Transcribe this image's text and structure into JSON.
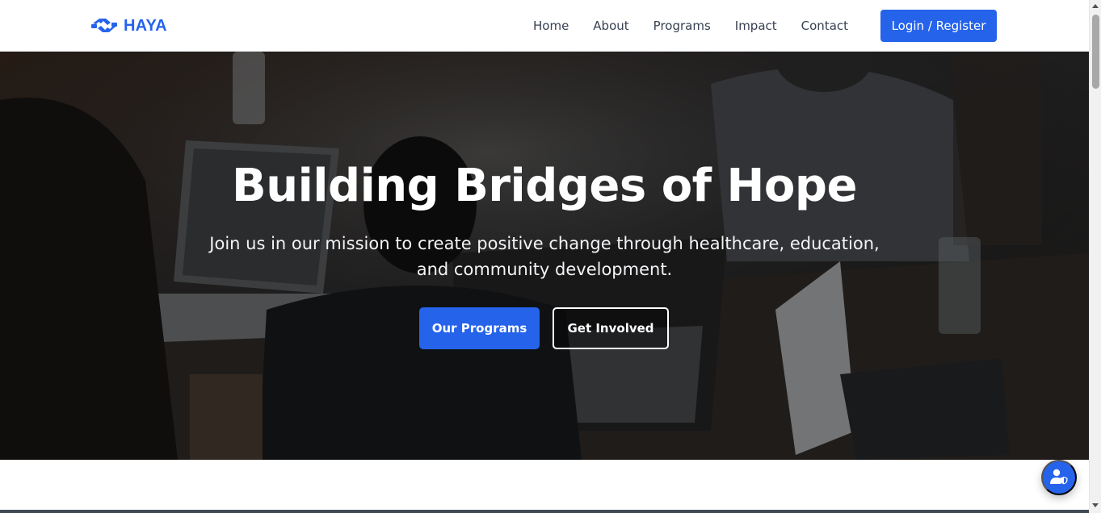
{
  "brand": {
    "name": "HAYA",
    "icon": "handshake-icon"
  },
  "nav": {
    "links": [
      {
        "label": "Home"
      },
      {
        "label": "About"
      },
      {
        "label": "Programs"
      },
      {
        "label": "Impact"
      },
      {
        "label": "Contact"
      }
    ],
    "login_label": "Login / Register"
  },
  "hero": {
    "title": "Building Bridges of Hope",
    "subtitle": "Join us in our mission to create positive change through healthcare, education, and community development.",
    "primary_label": "Our Programs",
    "secondary_label": "Get Involved"
  },
  "fab": {
    "icon": "user-shield-icon"
  },
  "colors": {
    "accent": "#2563eb",
    "nav_text": "#374151",
    "hero_overlay": "#000000",
    "white": "#ffffff"
  }
}
